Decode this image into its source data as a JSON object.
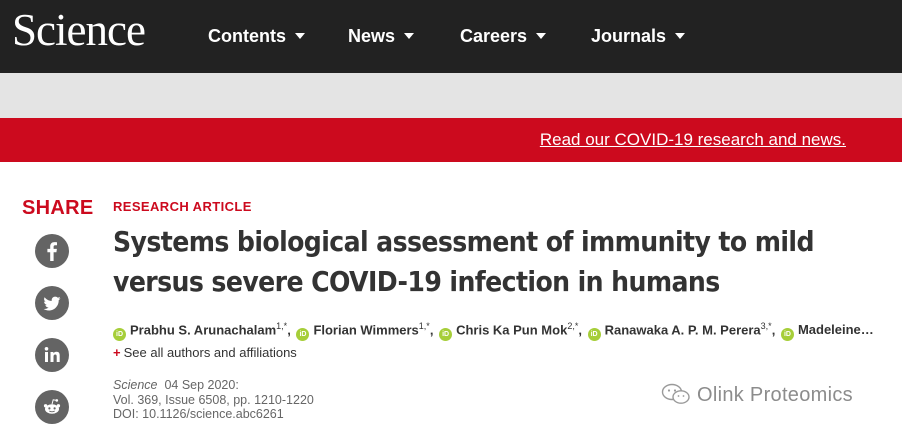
{
  "header": {
    "logo": "Science",
    "nav": [
      {
        "label": "Contents"
      },
      {
        "label": "News"
      },
      {
        "label": "Careers"
      },
      {
        "label": "Journals"
      }
    ]
  },
  "banner": {
    "link": "Read our COVID-19 research and news."
  },
  "share": {
    "label": "SHARE",
    "buttons": [
      {
        "icon": "facebook-icon"
      },
      {
        "icon": "twitter-icon"
      },
      {
        "icon": "linkedin-icon"
      },
      {
        "icon": "reddit-icon"
      }
    ]
  },
  "article": {
    "kicker": "RESEARCH ARTICLE",
    "title": "Systems biological assessment of immunity to mild versus severe COVID-19 infection in humans",
    "authors": [
      {
        "name": "Prabhu S. Arunachalam",
        "sup": "1,*",
        "sep": ","
      },
      {
        "name": "Florian Wimmers",
        "sup": "1,*",
        "sep": ","
      },
      {
        "name": "Chris Ka Pun Mok",
        "sup": "2,*",
        "sep": ","
      },
      {
        "name": "Ranawaka A. P. M. Perera",
        "sup": "3,*",
        "sep": ","
      },
      {
        "name": "Madeleine…",
        "sup": "",
        "sep": ""
      }
    ],
    "orcid_label": "iD",
    "see_all_plus": "+",
    "see_all": "See all authors and affiliations",
    "citation": {
      "journal": "Science",
      "date": "04 Sep 2020:",
      "volume": "Vol. 369, Issue 6508, pp. 1210-1220",
      "doi": "DOI: 10.1126/science.abc6261"
    }
  },
  "watermark": "Olink Proteomics",
  "colors": {
    "brand_red": "#cc0a1e",
    "nav_bg": "#222222",
    "orcid_green": "#a6ce39"
  }
}
